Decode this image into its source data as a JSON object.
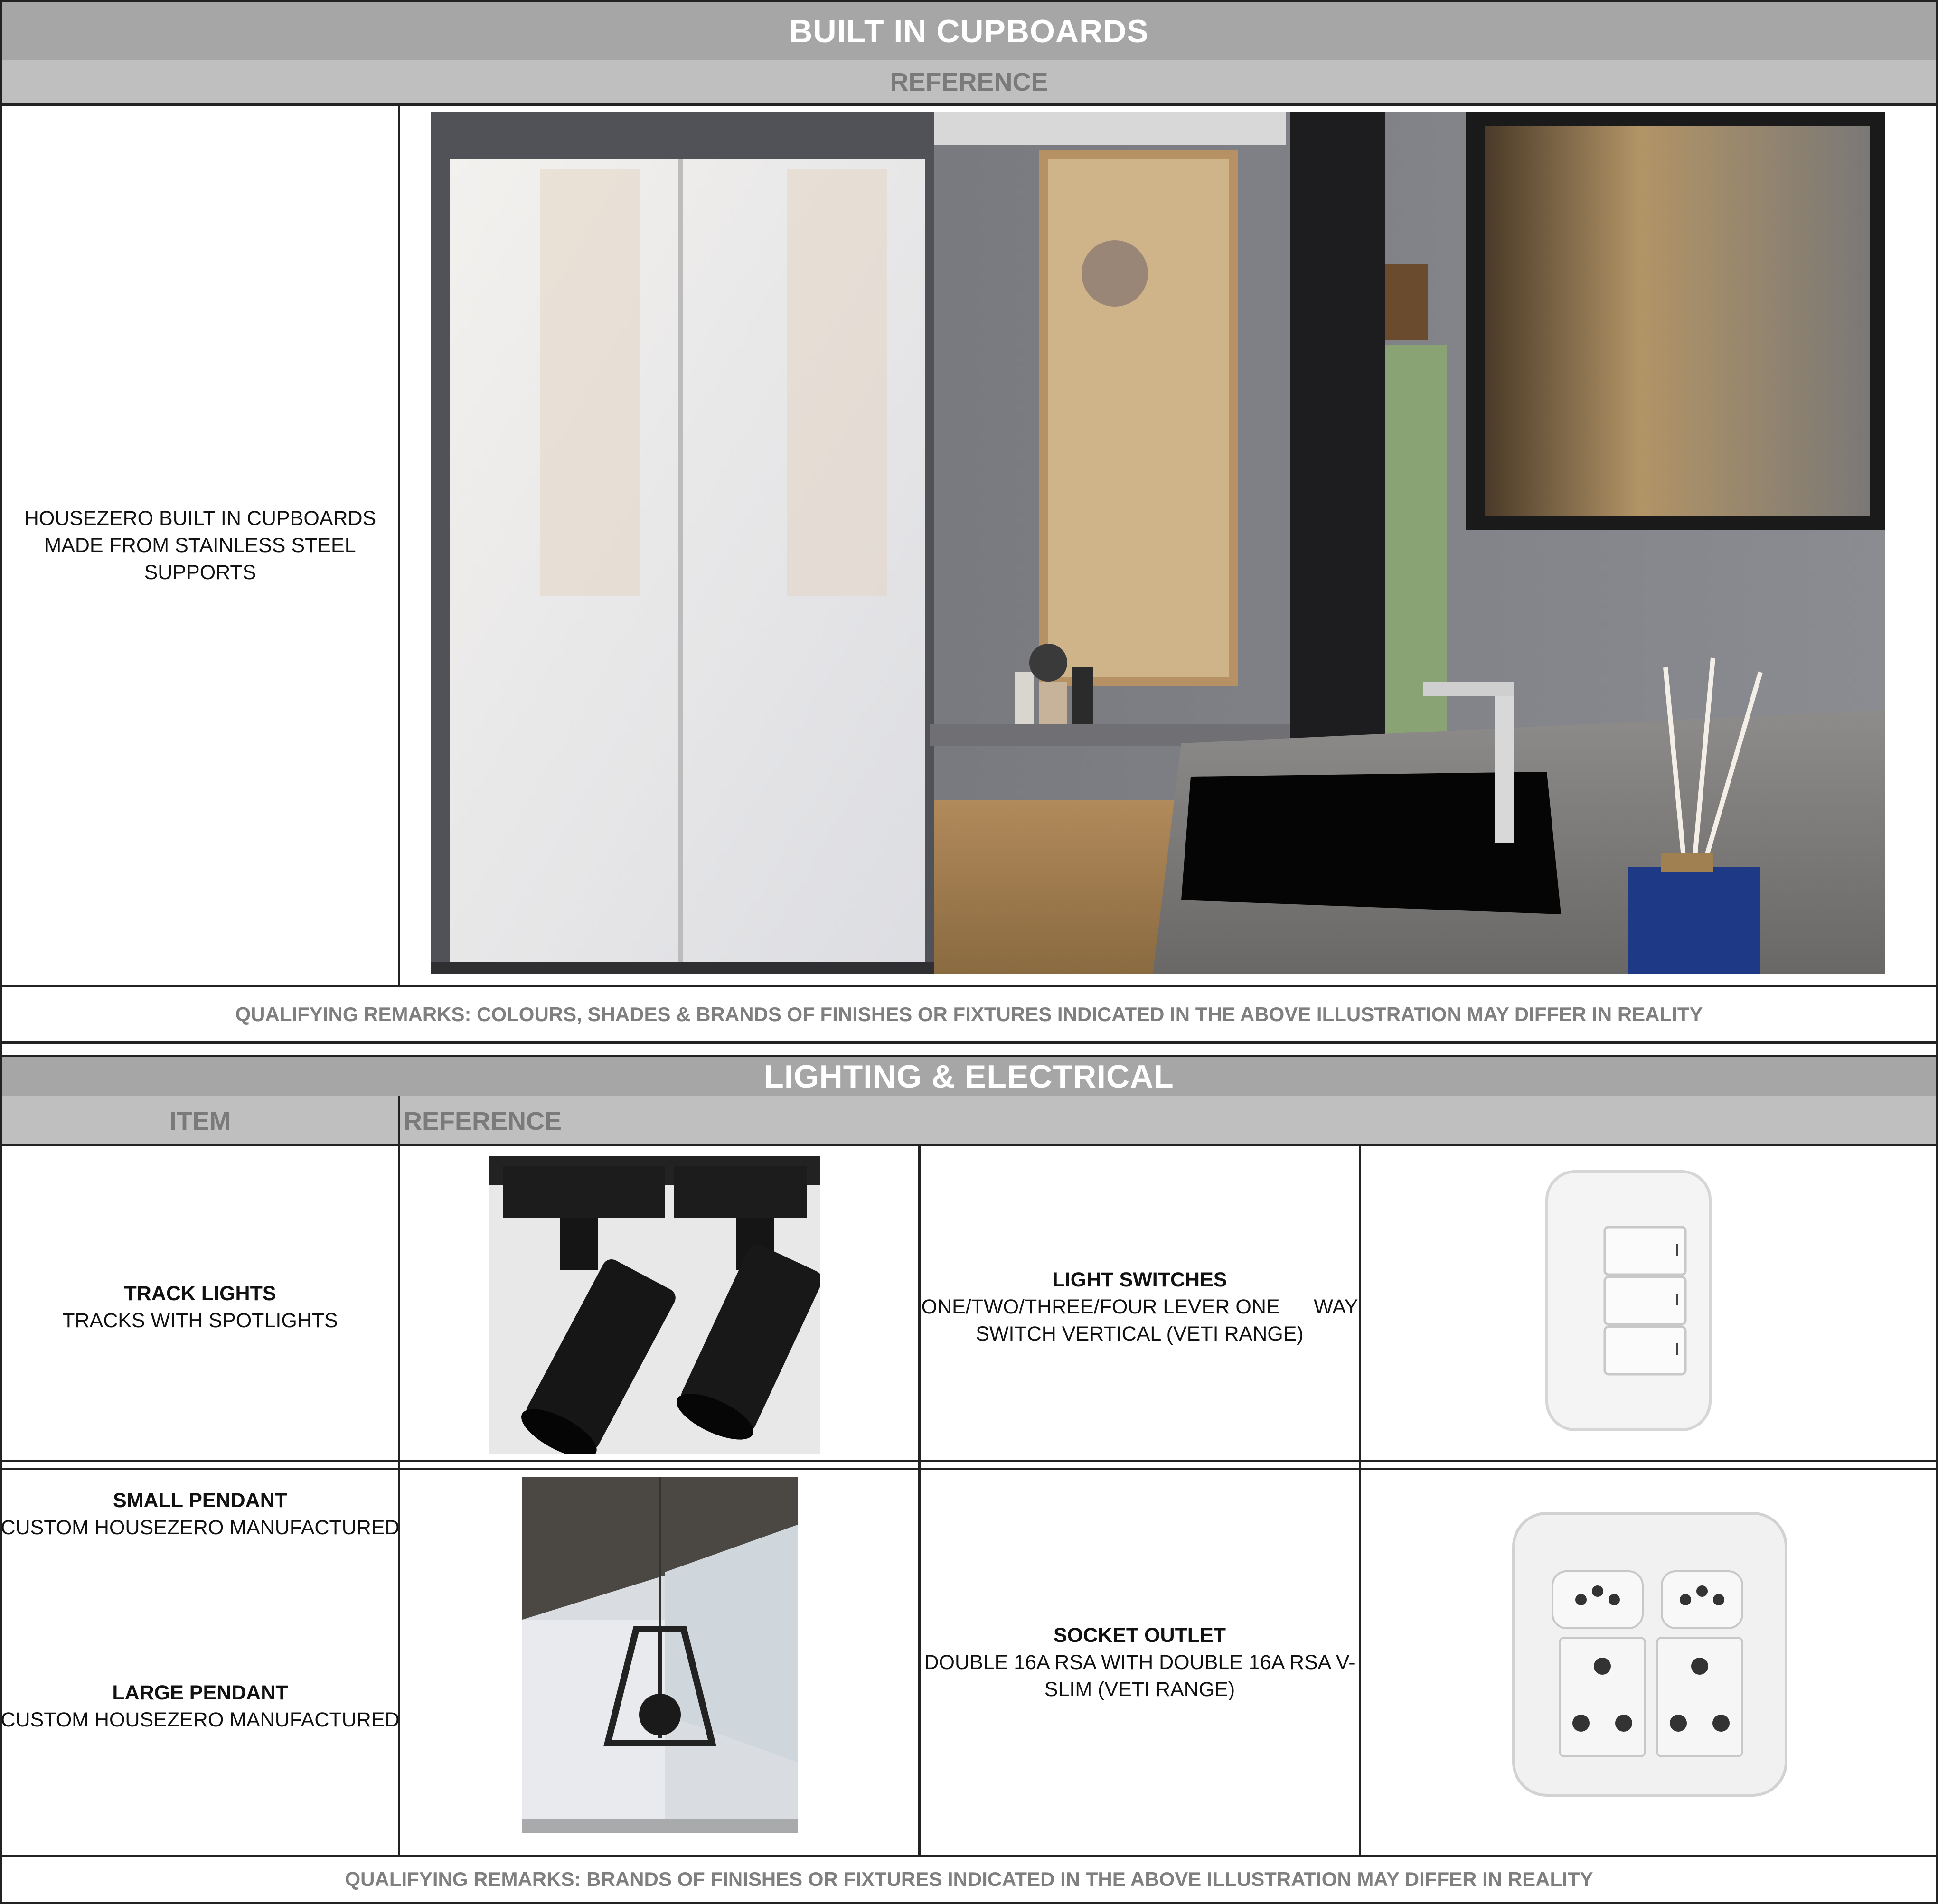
{
  "section1": {
    "title": "BUILT IN CUPBOARDS",
    "reference_header": "REFERENCE",
    "item_line1": "HOUSEZERO BUILT IN CUPBOARDS",
    "item_line2": "MADE FROM STAINLESS STEEL SUPPORTS",
    "remark": "QUALIFYING REMARKS: COLOURS, SHADES & BRANDS OF FINISHES OR FIXTURES INDICATED IN THE ABOVE ILLUSTRATION MAY DIFFER IN REALITY"
  },
  "section2": {
    "title": "LIGHTING & ELECTRICAL",
    "col_item": "ITEM",
    "col_reference": "REFERENCE",
    "track_title": "TRACK LIGHTS",
    "track_desc": "TRACKS WITH SPOTLIGHTS",
    "switch_title": "LIGHT SWITCHES",
    "switch_desc1": "ONE/TWO/THREE/FOUR LEVER ONE      WAY",
    "switch_desc2": "SWITCH VERTICAL (VETI RANGE)",
    "small_pendant_title": "SMALL PENDANT",
    "small_pendant_desc": "CUSTOM HOUSEZERO MANUFACTURED",
    "large_pendant_title": "LARGE PENDANT",
    "large_pendant_desc": "CUSTOM HOUSEZERO MANUFACTURED",
    "socket_title": "SOCKET OUTLET",
    "socket_desc1": "DOUBLE 16A RSA WITH DOUBLE 16A RSA V-",
    "socket_desc2": "SLIM (VETI RANGE)",
    "remark": "QUALIFYING REMARKS: BRANDS OF FINISHES OR FIXTURES INDICATED IN THE ABOVE ILLUSTRATION MAY DIFFER IN REALITY"
  },
  "colors": {
    "header_dark": "#a6a6a6",
    "header_light": "#bfbfbf",
    "remark_text": "#7f7f7f",
    "border": "#222222"
  }
}
